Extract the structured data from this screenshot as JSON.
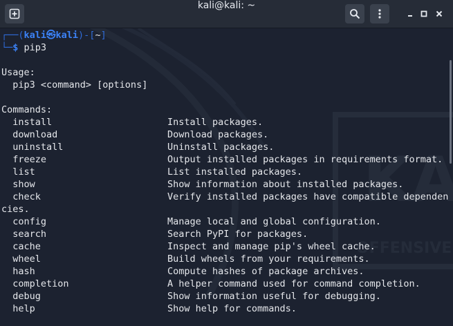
{
  "window": {
    "title": "kali@kali: ~"
  },
  "icons": {
    "new_tab": "new-tab-icon",
    "search": "search-icon",
    "menu": "kebab-menu-icon",
    "minimize": "minimize-icon",
    "maximize": "maximize-icon",
    "close": "close-icon"
  },
  "colors": {
    "prompt_lines": "#2f6bd8",
    "prompt_user": "#3b82f6",
    "text": "#e5e7eb",
    "background": "#1c2230"
  },
  "prompt": {
    "line1_prefix": "┌──(",
    "user": "kali㉿kali",
    "line1_mid": ")-[",
    "path": "~",
    "line1_end": "]",
    "line2_prefix": "└─",
    "symbol": "$",
    "command": " pip3"
  },
  "usage": {
    "heading": "Usage:",
    "syntax": "  pip3 <command> [options]"
  },
  "commands_heading": "Commands:",
  "commands": [
    {
      "name": "install",
      "desc": "Install packages."
    },
    {
      "name": "download",
      "desc": "Download packages."
    },
    {
      "name": "uninstall",
      "desc": "Uninstall packages."
    },
    {
      "name": "freeze",
      "desc": "Output installed packages in requirements format."
    },
    {
      "name": "list",
      "desc": "List installed packages."
    },
    {
      "name": "show",
      "desc": "Show information about installed packages."
    },
    {
      "name": "check",
      "desc": "Verify installed packages have compatible dependen"
    }
  ],
  "wrap_continuation": "cies.",
  "commands2": [
    {
      "name": "config",
      "desc": "Manage local and global configuration."
    },
    {
      "name": "search",
      "desc": "Search PyPI for packages."
    },
    {
      "name": "cache",
      "desc": "Inspect and manage pip's wheel cache."
    },
    {
      "name": "wheel",
      "desc": "Build wheels from your requirements."
    },
    {
      "name": "hash",
      "desc": "Compute hashes of package archives."
    },
    {
      "name": "completion",
      "desc": "A helper command used for command completion."
    },
    {
      "name": "debug",
      "desc": "Show information useful for debugging."
    },
    {
      "name": "help",
      "desc": "Show help for commands."
    }
  ]
}
